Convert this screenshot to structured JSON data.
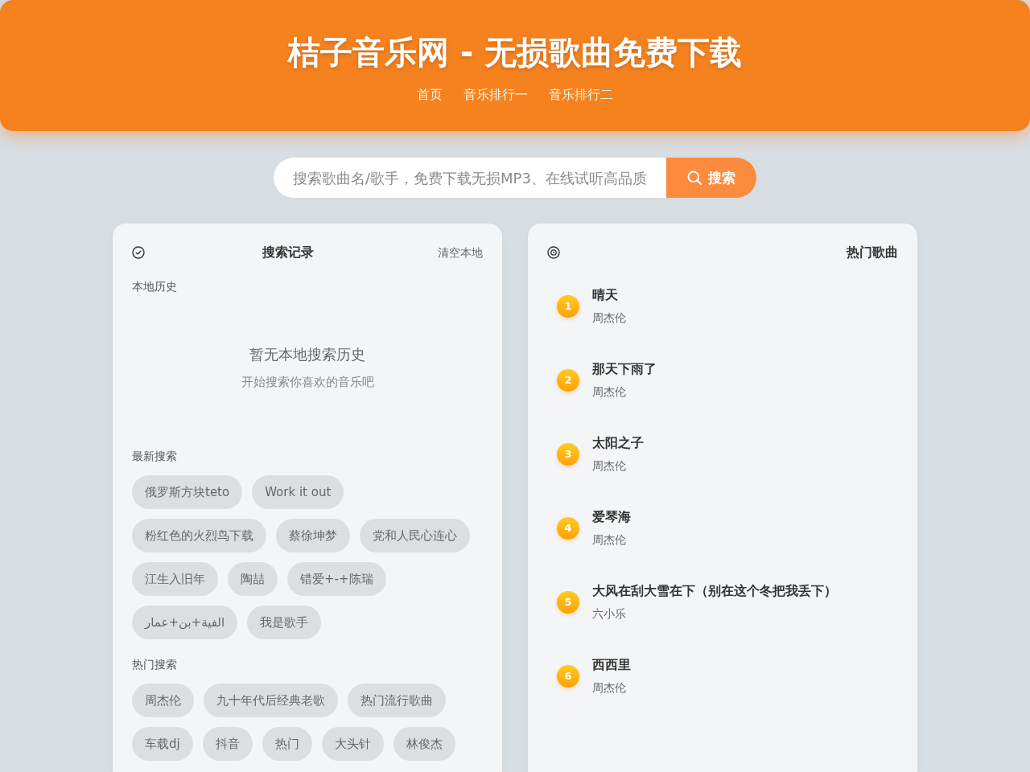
{
  "header": {
    "title": "桔子音乐网 - 无损歌曲免费下载",
    "nav": [
      "首页",
      "音乐排行一",
      "音乐排行二"
    ]
  },
  "search": {
    "placeholder": "搜索歌曲名/歌手，免费下载无损MP3、在线试听高品质",
    "button": "搜索"
  },
  "history_panel": {
    "title": "搜索记录",
    "clear_button": "清空本地",
    "local_history": {
      "heading": "本地历史",
      "empty_title": "暂无本地搜索历史",
      "empty_hint": "开始搜索你喜欢的音乐吧"
    },
    "recent": {
      "heading": "最新搜索",
      "tags": [
        "俄罗斯方块teto",
        "Work it out",
        "粉红色的火烈鸟下载",
        "蔡徐坤梦",
        "党和人民心连心",
        "江生入旧年",
        "陶喆",
        "错爱+-+陈瑞",
        "الفية+بن+عمار",
        "我是歌手"
      ]
    },
    "hot": {
      "heading": "热门搜索",
      "tags": [
        "周杰伦",
        "九十年代后经典老歌",
        "热门流行歌曲",
        "车载dj",
        "抖音",
        "热门",
        "大头针",
        "林俊杰"
      ]
    }
  },
  "hot_songs_panel": {
    "title": "热门歌曲",
    "songs": [
      {
        "rank": "1",
        "title": "晴天",
        "artist": "周杰伦"
      },
      {
        "rank": "2",
        "title": "那天下雨了",
        "artist": "周杰伦"
      },
      {
        "rank": "3",
        "title": "太阳之子",
        "artist": "周杰伦"
      },
      {
        "rank": "4",
        "title": "爱琴海",
        "artist": "周杰伦"
      },
      {
        "rank": "5",
        "title": "大风在刮大雪在下（别在这个冬把我丢下）",
        "artist": "六小乐"
      },
      {
        "rank": "6",
        "title": "西西里",
        "artist": "周杰伦"
      }
    ]
  }
}
